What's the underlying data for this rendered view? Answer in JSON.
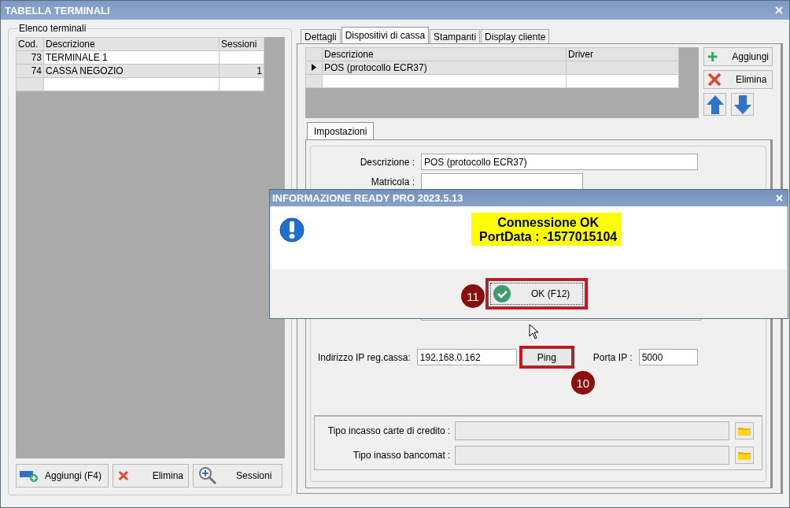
{
  "window": {
    "title": "TABELLA TERMINALI"
  },
  "terminals": {
    "title": "Elenco terminali",
    "columns": [
      "Cod.",
      "Descrizione",
      "Sessioni"
    ],
    "rows": [
      {
        "code": "73",
        "description": "TERMINALE 1",
        "selected": false
      },
      {
        "code": "74",
        "description": "CASSA NEGOZIO",
        "sessions": "1",
        "selected": true
      }
    ],
    "buttons": [
      {
        "label": "Aggiungi (F4)",
        "kind": "add-card"
      },
      {
        "label": "Elimina",
        "kind": "delete"
      },
      {
        "label": "Sessioni",
        "kind": "zoom"
      }
    ]
  },
  "tabs": [
    {
      "label": "Dettagli",
      "selected": false
    },
    {
      "label": "Dispositivi di cassa",
      "selected": true
    },
    {
      "label": "Stampanti",
      "selected": false
    },
    {
      "label": "Display cliente",
      "selected": false
    }
  ],
  "devices": {
    "columns": [
      "Descrizione",
      "Driver"
    ],
    "rows": [
      {
        "description": "POS (protocollo ECR37)",
        "current": true
      }
    ],
    "buttons": [
      {
        "label": "Aggiungi",
        "kind": "add"
      },
      {
        "label": "Elimina",
        "kind": "delete"
      }
    ],
    "move_buttons": [
      {
        "kind": "up"
      },
      {
        "kind": "down"
      }
    ]
  },
  "settings": {
    "tab": "Impostazioni",
    "description": {
      "label": "Descrizione :",
      "value": "POS (protocollo ECR37)"
    },
    "serial": {
      "label": "Matricola :"
    },
    "ip": {
      "label": "Indirizzo IP reg.cassa:",
      "value": "192.168.0.162"
    },
    "ping": {
      "label": "Ping",
      "callout": "10"
    },
    "port": {
      "label": "Porta IP :",
      "value": "5000"
    },
    "payments": [
      {
        "label": "Tipo incasso carte di credito :"
      },
      {
        "label": "Tipo inasso bancomat :"
      }
    ]
  },
  "dialog": {
    "title": "INFORMAZIONE READY PRO 2023.5.13",
    "message": [
      "Connessione OK",
      "PortData : -1577015104"
    ],
    "button": {
      "label": "OK (F12)",
      "callout": "11"
    }
  }
}
